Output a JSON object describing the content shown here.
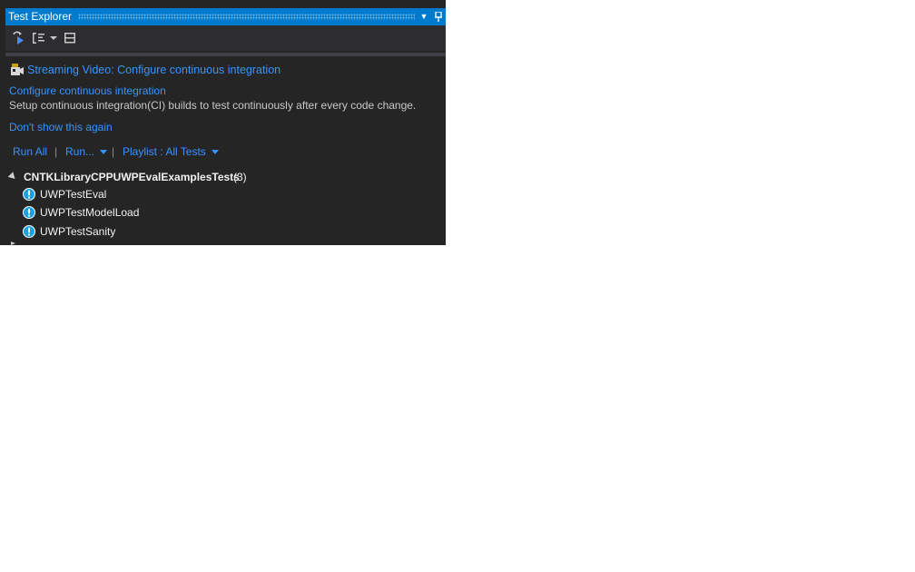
{
  "window": {
    "title": "Test Explorer",
    "dropdown_icon": "chevron-down-icon",
    "pin_icon": "pin-icon"
  },
  "toolbar": {
    "icons": [
      "refresh-link-icon",
      "group-by-icon",
      "dropdown-caret-icon",
      "playlist-icon"
    ]
  },
  "notification": {
    "video_link": "Streaming Video: Configure continuous integration",
    "configure_link": "Configure continuous integration",
    "description": "Setup continuous integration(CI) builds to test continuously after every code change.",
    "dismiss_link": "Don't show this again"
  },
  "actions": {
    "run_all": "Run All",
    "separator": "|",
    "run": "Run...",
    "playlist": "Playlist : All Tests"
  },
  "tree": {
    "group_name": "CNTKLibraryCPPUWPEvalExamplesTests",
    "group_count": "(3)",
    "tests": [
      {
        "name": "UWPTestEval",
        "status_icon": "not-run-info-icon"
      },
      {
        "name": "UWPTestModelLoad",
        "status_icon": "not-run-info-icon"
      },
      {
        "name": "UWPTestSanity",
        "status_icon": "not-run-info-icon"
      }
    ]
  },
  "colors": {
    "accent": "#007acc",
    "panel_bg": "#252526",
    "link": "#3794ff"
  }
}
